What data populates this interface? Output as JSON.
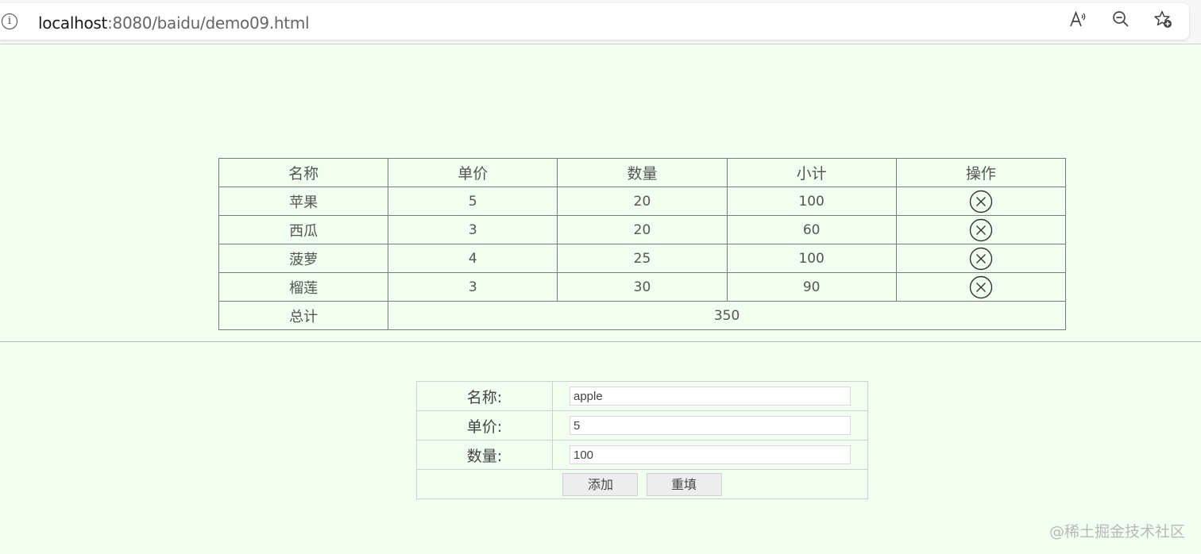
{
  "browser": {
    "url_host": "localhost",
    "url_rest": ":8080/baidu/demo09.html",
    "info_glyph": "i",
    "icons": [
      "read-aloud-icon",
      "zoom-out-icon",
      "add-favorite-icon"
    ]
  },
  "cart_table": {
    "headers": [
      "名称",
      "单价",
      "数量",
      "小计",
      "操作"
    ],
    "rows": [
      {
        "name": "苹果",
        "price": "5",
        "qty": "20",
        "subtotal": "100"
      },
      {
        "name": "西瓜",
        "price": "3",
        "qty": "20",
        "subtotal": "60"
      },
      {
        "name": "菠萝",
        "price": "4",
        "qty": "25",
        "subtotal": "100"
      },
      {
        "name": "榴莲",
        "price": "3",
        "qty": "30",
        "subtotal": "90"
      }
    ],
    "total_label": "总计",
    "total_value": "350",
    "delete_icon": "circle-x-icon"
  },
  "add_form": {
    "name_label": "名称:",
    "name_value": "apple",
    "price_label": "单价:",
    "price_value": "5",
    "qty_label": "数量:",
    "qty_value": "100",
    "add_button": "添加",
    "reset_button": "重填"
  },
  "watermark": "@稀土掘金技术社区",
  "colors": {
    "page_background": "#f0fff0",
    "table_border": "#7a7a7a",
    "text": "#555555"
  }
}
